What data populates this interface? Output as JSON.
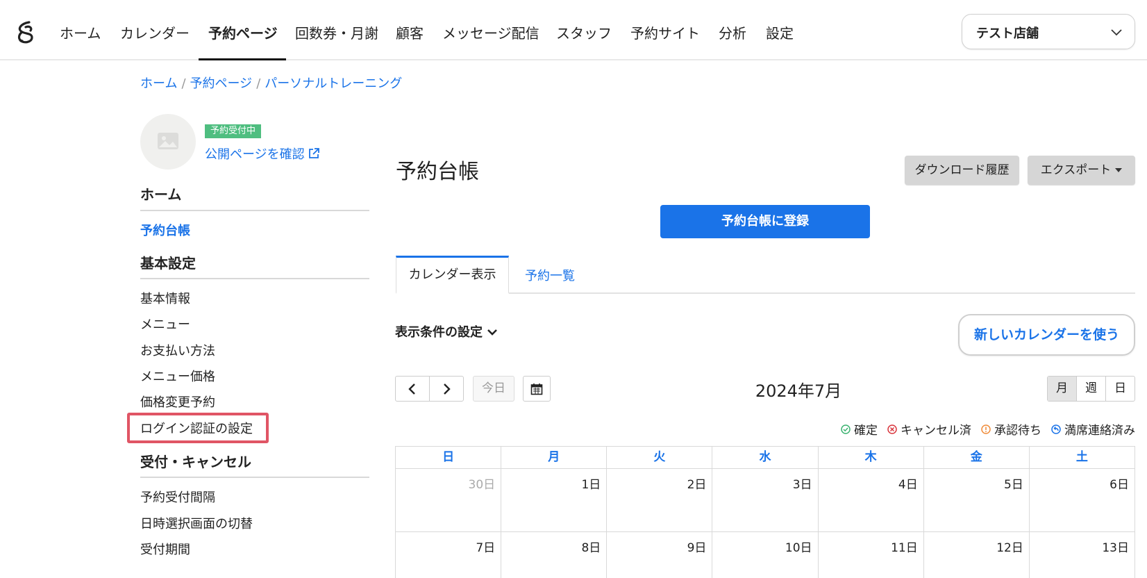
{
  "nav": {
    "items": [
      "ホーム",
      "カレンダー",
      "予約ページ",
      "回数券・月謝",
      "顧客",
      "メッセージ配信",
      "スタッフ",
      "予約サイト",
      "分析",
      "設定"
    ],
    "active_index": 2,
    "store_name": "テスト店舗"
  },
  "breadcrumb": [
    "ホーム",
    "予約ページ",
    "パーソナルトレーニング"
  ],
  "sidebar": {
    "badge": "予約受付中",
    "public_link": "公開ページを確認",
    "home_heading": "ホーム",
    "active_item": "予約台帳",
    "basic_heading": "基本設定",
    "basic_items": [
      "基本情報",
      "メニュー",
      "お支払い方法",
      "メニュー価格",
      "価格変更予約",
      "ログイン認証の設定"
    ],
    "reception_heading": "受付・キャンセル",
    "reception_items": [
      "予約受付間隔",
      "日時選択画面の切替",
      "受付期間"
    ]
  },
  "main": {
    "title": "予約台帳",
    "download_history": "ダウンロード履歴",
    "export": "エクスポート",
    "register_button": "予約台帳に登録",
    "tabs": [
      "カレンダー表示",
      "予約一覧"
    ],
    "filter_label": "表示条件の設定",
    "new_calendar_button": "新しいカレンダーを使う",
    "today_button": "今日",
    "month_title": "2024年7月",
    "views": [
      "月",
      "週",
      "日"
    ],
    "active_view": "月",
    "legend": [
      {
        "label": "確定",
        "color": "#3cb371"
      },
      {
        "label": "キャンセル済",
        "color": "#d9363e"
      },
      {
        "label": "承認待ち",
        "color": "#f08c3a"
      },
      {
        "label": "満席連絡済み",
        "color": "#1a73e8"
      }
    ],
    "weekdays": [
      "日",
      "月",
      "火",
      "水",
      "木",
      "金",
      "土"
    ],
    "weeks": [
      [
        "30日",
        "1日",
        "2日",
        "3日",
        "4日",
        "5日",
        "6日"
      ],
      [
        "7日",
        "8日",
        "9日",
        "10日",
        "11日",
        "12日",
        "13日"
      ]
    ]
  },
  "colors": {
    "accent": "#1a73e8",
    "badge_green": "#4fbe80",
    "highlight_red": "#e05565"
  }
}
